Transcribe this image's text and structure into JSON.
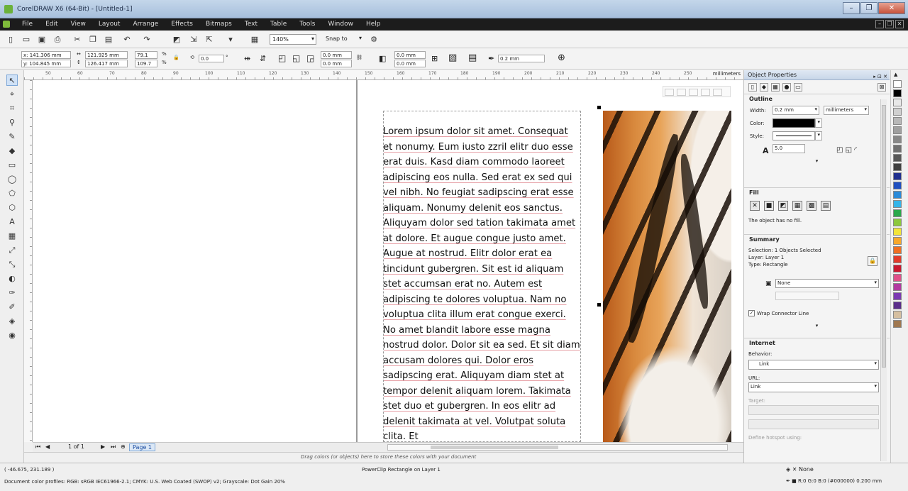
{
  "window": {
    "title": "CorelDRAW X6 (64-Bit) - [Untitled-1]",
    "controls": [
      "–",
      "❐",
      "✕"
    ]
  },
  "menu": {
    "items": [
      "File",
      "Edit",
      "View",
      "Layout",
      "Arrange",
      "Effects",
      "Bitmaps",
      "Text",
      "Table",
      "Tools",
      "Window",
      "Help"
    ],
    "mdi_controls": [
      "–",
      "❐",
      "✕"
    ]
  },
  "standard_toolbar": {
    "zoom_level": "140%",
    "snap_to": "Snap to"
  },
  "property_bar": {
    "x": "x: 141.306 mm",
    "y": "y: 104.845 mm",
    "width": "121.925 mm",
    "height": "126.417 mm",
    "scale_w": "79.1",
    "scale_h": "109.7",
    "percent": "%",
    "rotation": "0.0",
    "rotation_unit": "°",
    "pos_a": "0.0 mm",
    "pos_b": "0.0 mm",
    "corner_a": "0.0 mm",
    "corner_b": "0.0 mm",
    "outline_width": "0.2 mm"
  },
  "ruler": {
    "unit": "millimeters",
    "ticks": [
      "50",
      "60",
      "70",
      "80",
      "90",
      "100",
      "110",
      "120",
      "130",
      "140",
      "150",
      "160",
      "170",
      "180",
      "190",
      "200",
      "210",
      "220",
      "230",
      "240",
      "250"
    ]
  },
  "document": {
    "paragraph": "Lorem ipsum dolor sit amet. Consequat et nonumy. Eum iusto zzril elitr duo esse erat duis. Kasd diam commodo laoreet adipiscing eos nulla. Sed erat ex sed qui vel nibh. No feugiat sadipscing erat esse aliquam. Nonumy delenit eos sanctus. Aliquyam dolor sed tation takimata amet at dolore. Et augue congue justo amet. Augue at nostrud. Elitr dolor erat ea tincidunt gubergren. Sit est id aliquam stet accumsan erat no. Autem est adipiscing te dolores voluptua. Nam no voluptua clita illum erat congue exerci. No amet blandit labore esse magna nostrud dolor. Dolor sit ea sed. Et sit diam accusam dolores qui. Dolor eros sadipscing erat. Aliquyam diam stet at tempor delenit aliquam lorem. Takimata stet duo et gubergren. In eos elitr ad delenit takimata at vel. Volutpat soluta clita. Et"
  },
  "page_nav": {
    "counter": "1 of 1",
    "page_tab": "Page 1"
  },
  "color_hint": "Drag colors (or objects) here to store these colors with your document",
  "status_bar": {
    "cursor": "( -46.675, 231.189 )",
    "selection": "PowerClip Rectangle on Layer 1",
    "profiles": "Document color profiles: RGB: sRGB IEC61966-2.1; CMYK: U.S. Web Coated (SWOP) v2; Grayscale: Dot Gain 20%",
    "fill": "None",
    "outline": "R:0 G:0 B:0 (#000000)  0.200 mm"
  },
  "docker": {
    "title": "Object Properties",
    "outline": {
      "header": "Outline",
      "width_label": "Width:",
      "width_value": "0.2 mm",
      "unit": "millimeters",
      "color_label": "Color:",
      "style_label": "Style:",
      "miter": "5.0"
    },
    "fill": {
      "header": "Fill",
      "note": "The object has no fill."
    },
    "summary": {
      "header": "Summary",
      "selection": "Selection: 1 Objects Selected",
      "layer": "Layer:   Layer 1",
      "type": "Type:    Rectangle",
      "style_value": "None",
      "wrap_label": "Wrap Connector Line"
    },
    "internet": {
      "header": "Internet",
      "behavior_label": "Behavior:",
      "behavior_value": "Link",
      "url_label": "URL:",
      "url_value": "Link",
      "target_label": "Target:",
      "hotspot_label": "Define hotspot using:"
    }
  },
  "palette_colors": [
    "#ffffff",
    "#000000",
    "#e8e8e8",
    "#d0d0d0",
    "#b8b8b8",
    "#a0a0a0",
    "#888888",
    "#707070",
    "#585858",
    "#404040",
    "#1f2f8f",
    "#2050c0",
    "#2a8ad8",
    "#36b4e8",
    "#2aa84a",
    "#8cc83c",
    "#f2e53a",
    "#f7a82c",
    "#ef6f23",
    "#e23b2b",
    "#c9182f",
    "#e0508a",
    "#b23aa0",
    "#7b3ab2",
    "#5a2e8a",
    "#d6bfa0",
    "#a07850"
  ]
}
